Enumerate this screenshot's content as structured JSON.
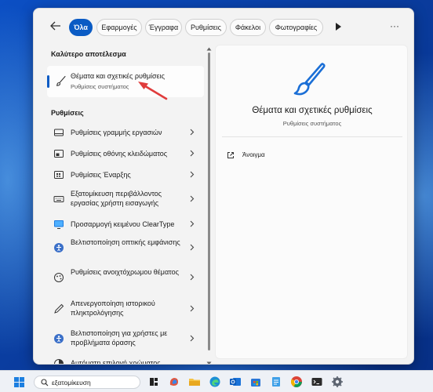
{
  "filters": {
    "tabs": [
      {
        "label": "Όλα",
        "active": true
      },
      {
        "label": "Εφαρμογές"
      },
      {
        "label": "Έγγραφα"
      },
      {
        "label": "Ρυθμίσεις"
      },
      {
        "label": "Φάκελοι"
      },
      {
        "label": "Φωτογραφίες"
      }
    ],
    "back_icon": "back-arrow-icon",
    "play_icon": "play-icon",
    "more_icon": "more-icon"
  },
  "results": {
    "best_header": "Καλύτερο αποτέλεσμα",
    "best": {
      "title": "Θέματα και σχετικές ρυθμίσεις",
      "subtitle": "Ρυθμίσεις συστήματος",
      "icon": "paintbrush-icon"
    },
    "settings_header": "Ρυθμίσεις",
    "items": [
      {
        "label": "Ρυθμίσεις γραμμής εργασιών",
        "icon": "taskbar-icon"
      },
      {
        "label": "Ρυθμίσεις οθόνης κλειδώματος",
        "icon": "lock-screen-icon"
      },
      {
        "label": "Ρυθμίσεις Έναρξης",
        "icon": "start-menu-icon"
      },
      {
        "label": "Εξατομίκευση περιβάλλοντος εργασίας χρήστη εισαγωγής",
        "icon": "keyboard-icon"
      },
      {
        "label": "Προσαρμογή κειμένου ClearType",
        "icon": "monitor-icon"
      },
      {
        "label": "Βελτιστοποίηση οπτικής εμφάνισης",
        "icon": "accessibility-icon"
      },
      {
        "label": "Ρυθμίσεις ανοιχτόχρωμου θέματος",
        "icon": "theme-icon"
      },
      {
        "label": "Απενεργοποίηση ιστορικού πληκτρολόγησης",
        "icon": "pen-icon"
      },
      {
        "label": "Βελτιστοποίηση για χρήστες με προβλήματα όρασης",
        "icon": "accessibility-icon"
      },
      {
        "label": "Αυτόματη επιλογή χρώματος",
        "icon": "color-icon"
      }
    ]
  },
  "detail": {
    "title": "Θέματα και σχετικές ρυθμίσεις",
    "subtitle": "Ρυθμίσεις συστήματος",
    "icon": "paintbrush-icon",
    "open_label": "Άνοιγμα",
    "open_icon": "open-external-icon"
  },
  "taskbar": {
    "search_value": "εξατομίκευση",
    "icons": [
      "start-icon",
      "search-icon",
      "task-view-icon",
      "copilot-icon",
      "file-explorer-icon",
      "edge-icon",
      "outlook-icon",
      "store-icon",
      "notepad-icon",
      "chrome-icon",
      "terminal-icon",
      "settings-icon"
    ]
  },
  "colors": {
    "accent": "#0a5bc4",
    "annotation_arrow": "#e03c3c"
  }
}
